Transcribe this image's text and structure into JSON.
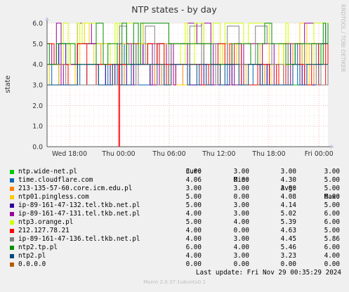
{
  "title": "NTP states - by day",
  "side_label": "RRDTOOL / TOBI OETIKER",
  "ylabel": "state",
  "chart_data": {
    "type": "line",
    "title": "NTP states - by day",
    "ylabel": "state",
    "xlabel": "",
    "ylim": [
      0,
      6
    ],
    "y_ticks": [
      "0.0",
      "1.0",
      "2.0",
      "3.0",
      "4.0",
      "5.0",
      "6.0"
    ],
    "x_ticks": [
      "Wed 18:00",
      "Thu 00:00",
      "Thu 06:00",
      "Thu 12:00",
      "Thu 18:00",
      "Fri 00:00"
    ],
    "grid": true,
    "legend_placement": "bottom",
    "series": [
      {
        "name": "ntp.wide-net.pl",
        "color": "#00cc00",
        "cur": "3.00",
        "min": "3.00",
        "avg": "3.00",
        "max": "3.00"
      },
      {
        "name": "time.cloudflare.com",
        "color": "#0066b3",
        "cur": "4.06",
        "min": "0.00",
        "avg": "4.30",
        "max": "5.00"
      },
      {
        "name": "213-135-57-60.core.icm.edu.pl",
        "color": "#ff8000",
        "cur": "3.00",
        "min": "3.00",
        "avg": "3.80",
        "max": "5.00"
      },
      {
        "name": "ntp01.pingless.com",
        "color": "#ffcc00",
        "cur": "5.00",
        "min": "0.00",
        "avg": "4.08",
        "max": "6.00"
      },
      {
        "name": "ip-89-161-47-132.tel.tkb.net.pl",
        "color": "#330099",
        "cur": "5.00",
        "min": "3.00",
        "avg": "4.14",
        "max": "5.00"
      },
      {
        "name": "ip-89-161-47-131.tel.tkb.net.pl",
        "color": "#990099",
        "cur": "4.00",
        "min": "3.00",
        "avg": "5.02",
        "max": "6.00"
      },
      {
        "name": "ntp3.orange.pl",
        "color": "#ccff00",
        "cur": "5.00",
        "min": "4.00",
        "avg": "5.39",
        "max": "6.00"
      },
      {
        "name": "212.127.78.21",
        "color": "#ff0000",
        "cur": "4.00",
        "min": "0.00",
        "avg": "4.63",
        "max": "5.00"
      },
      {
        "name": "ip-89-161-47-136.tel.tkb.net.pl",
        "color": "#808080",
        "cur": "4.00",
        "min": "3.00",
        "avg": "4.45",
        "max": "5.86"
      },
      {
        "name": "ntp2.tp.pl",
        "color": "#008f00",
        "cur": "6.00",
        "min": "4.00",
        "avg": "5.46",
        "max": "6.00"
      },
      {
        "name": "ntp2.pl",
        "color": "#00487d",
        "cur": "4.00",
        "min": "3.00",
        "avg": "3.23",
        "max": "4.00"
      },
      {
        "name": "0.0.0.0",
        "color": "#b35a00",
        "cur": "0.00",
        "min": "0.00",
        "avg": "0.00",
        "max": "0.00"
      }
    ]
  },
  "legend_headers": {
    "cur": "Cur:",
    "min": "Min:",
    "avg": "Avg:",
    "max": "Max:"
  },
  "last_update": "Last update: Fri Nov 29 00:35:29 2024",
  "munin_version": "Munin 2.0.37-1ubuntu0.1"
}
